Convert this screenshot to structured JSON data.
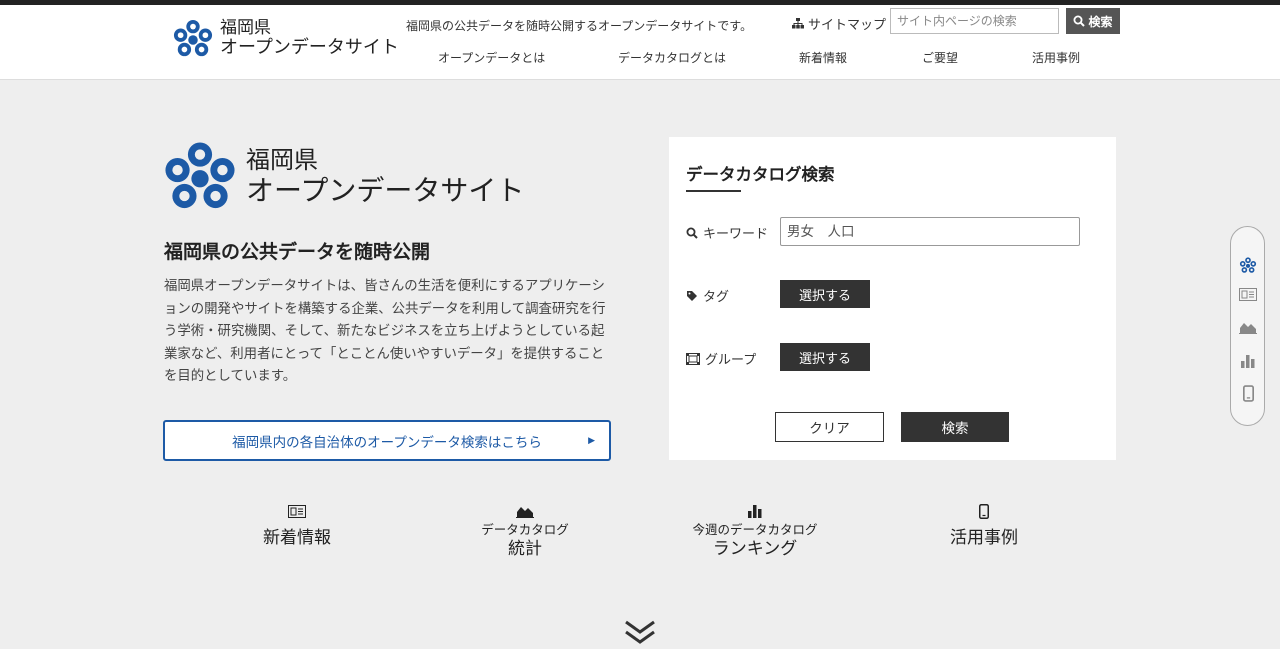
{
  "header": {
    "logo_line1": "福岡県",
    "logo_line2": "オープンデータサイト",
    "tagline": "福岡県の公共データを随時公開するオープンデータサイトです。",
    "sitemap_label": "サイトマップ",
    "search_placeholder": "サイト内ページの検索",
    "search_button": "検索",
    "nav": [
      "オープンデータとは",
      "データカタログとは",
      "新着情報",
      "ご要望",
      "活用事例"
    ]
  },
  "hero": {
    "logo_line1": "福岡県",
    "logo_line2": "オープンデータサイト",
    "title": "福岡県の公共データを随時公開",
    "description": "福岡県オープンデータサイトは、皆さんの生活を便利にするアプリケーションの開発やサイトを構築する企業、公共データを利用して調査研究を行う学術・研究機関、そして、新たなビジネスを立ち上げようとしている起業家など、利用者にとって「とことん使いやすいデータ」を提供することを目的としています。",
    "municipal_link": "福岡県内の各自治体のオープンデータ検索はこちら"
  },
  "catalog_search": {
    "title": "データカタログ検索",
    "keyword_label": "キーワード",
    "keyword_placeholder": "男女　人口",
    "tag_label": "タグ",
    "group_label": "グループ",
    "select_button": "選択する",
    "clear_button": "クリア",
    "search_button": "検索"
  },
  "features": [
    {
      "small": "",
      "large": "新着情報",
      "icon": "newspaper-icon"
    },
    {
      "small": "データカタログ",
      "large": "統計",
      "icon": "area-chart-icon"
    },
    {
      "small": "今週のデータカタログ",
      "large": "ランキング",
      "icon": "bar-chart-icon"
    },
    {
      "small": "",
      "large": "活用事例",
      "icon": "mobile-icon"
    }
  ],
  "side_rail": [
    "logo-mark-icon",
    "newspaper-icon",
    "area-chart-icon",
    "bar-chart-icon",
    "mobile-icon"
  ],
  "colors": {
    "brand_blue": "#1d5aa6",
    "dark": "#333333",
    "background": "#eeeeee"
  }
}
